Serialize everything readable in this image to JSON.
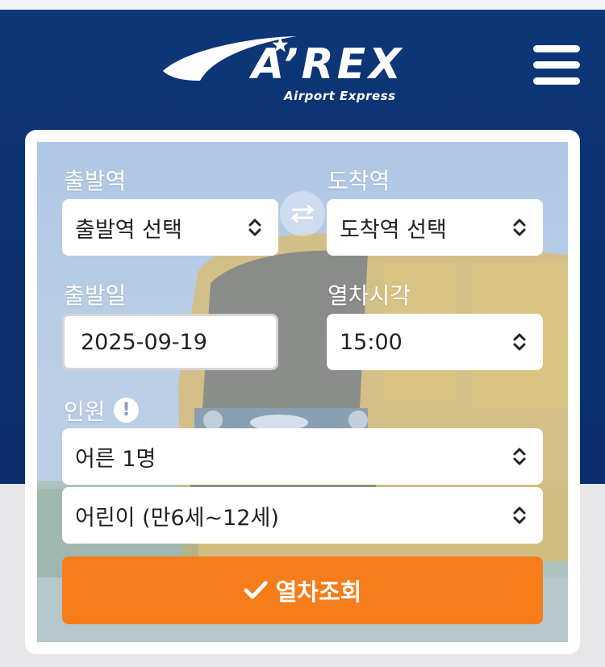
{
  "brand": {
    "logo_text": "A’REX",
    "logo_subtitle": "Airport Express"
  },
  "header": {
    "menu_icon": "hamburger-menu-icon"
  },
  "form": {
    "departure_label": "출발역",
    "departure_value": "출발역 선택",
    "arrival_label": "도착역",
    "arrival_value": "도착역 선택",
    "swap_icon": "swap-arrows-icon",
    "date_label": "출발일",
    "date_value": "2025-09-19",
    "time_label": "열차시각",
    "time_value": "15:00",
    "passengers_label": "인원",
    "info_icon_text": "!",
    "adult_value": "어른 1명",
    "child_value": "어린이 (만6세~12세)",
    "search_button": "열차조회"
  },
  "colors": {
    "header_blue": "#0b3273",
    "accent_orange": "#f77c1a",
    "page_gray": "#e7e7ea"
  }
}
